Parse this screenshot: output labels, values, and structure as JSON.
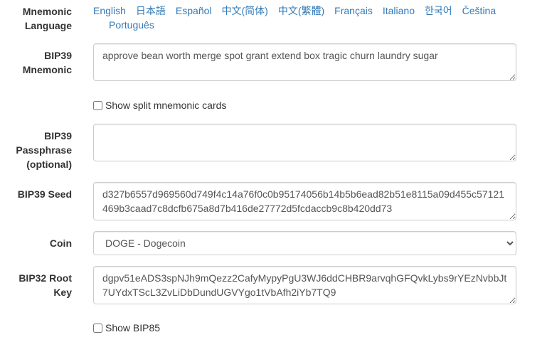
{
  "mnemonic_language": {
    "label": "Mnemonic Language",
    "languages": [
      "English",
      "日本語",
      "Español",
      "中文(简体)",
      "中文(繁體)",
      "Français",
      "Italiano",
      "한국어",
      "Čeština",
      "Português"
    ]
  },
  "bip39_mnemonic": {
    "label": "BIP39 Mnemonic",
    "value": "approve bean worth merge spot grant extend box tragic churn laundry sugar"
  },
  "split_cards": {
    "label": "Show split mnemonic cards",
    "checked": false
  },
  "bip39_passphrase": {
    "label": "BIP39 Passphrase (optional)",
    "value": ""
  },
  "bip39_seed": {
    "label": "BIP39 Seed",
    "value": "d327b6557d969560d749f4c14a76f0c0b95174056b14b5b6ead82b51e8115a09d455c57121469b3caad7c8dcfb675a8d7b416de27772d5fcdaccb9c8b420dd73"
  },
  "coin": {
    "label": "Coin",
    "selected": "DOGE - Dogecoin"
  },
  "bip32_root_key": {
    "label": "BIP32 Root Key",
    "value": "dgpv51eADS3spNJh9mQezz2CafyMypyPgU3WJ6ddCHBR9arvqhGFQvkLybs9rYEzNvbbJt7UYdxTScL3ZvLiDbDundUGVYgo1tVbAfh2iYb7TQ9"
  },
  "bip85": {
    "label": "Show BIP85",
    "checked": false
  },
  "colors": {
    "link": "#337ab7",
    "label_text": "#333333",
    "input_border": "#cccccc"
  }
}
